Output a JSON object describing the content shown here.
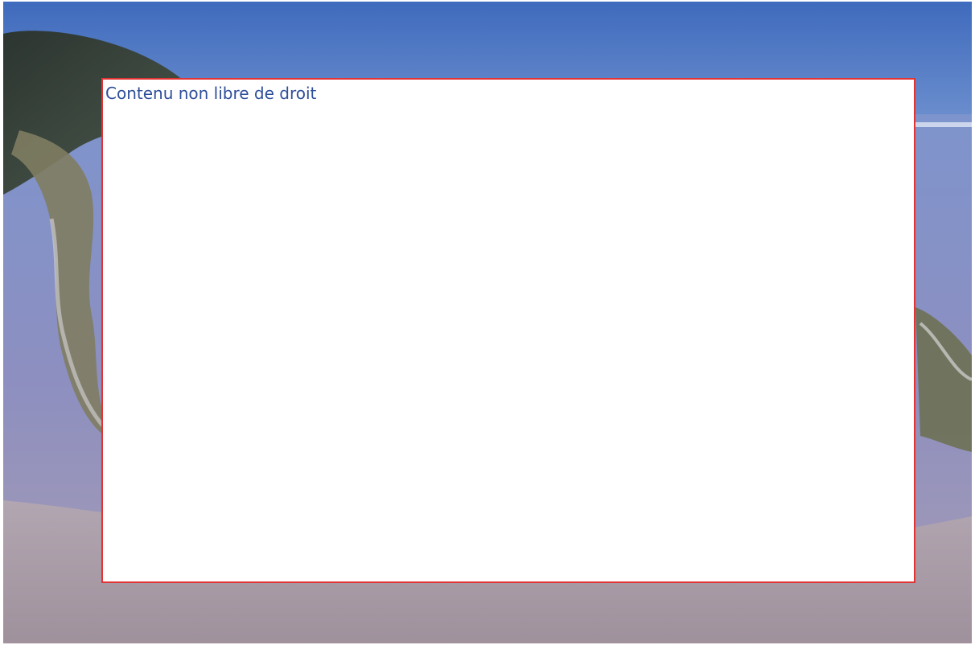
{
  "overlay": {
    "label": "Contenu non libre de droit"
  },
  "colors": {
    "label_text": "#2f4f9a",
    "box_border": "#e23434",
    "box_fill": "#ffffff"
  }
}
